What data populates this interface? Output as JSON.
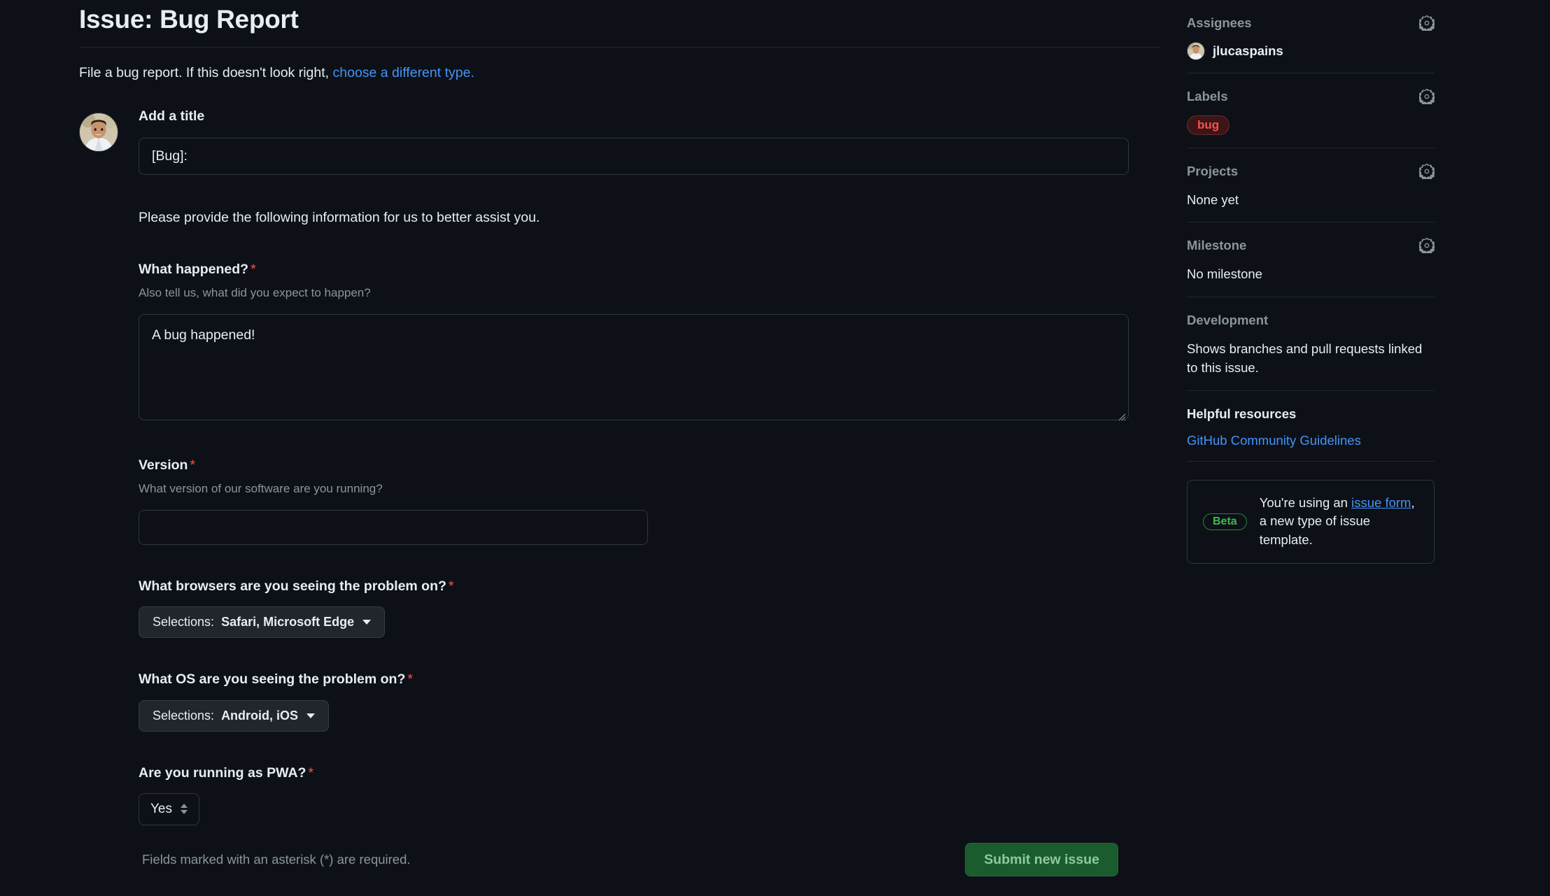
{
  "header": {
    "title": "Issue: Bug Report",
    "intro_prefix": "File a bug report. If this doesn't look right, ",
    "intro_link": "choose a different type."
  },
  "compose": {
    "title_label": "Add a title",
    "title_value": "[Bug]:",
    "title_placeholder": "Title"
  },
  "form": {
    "helper_text": "Please provide the following information for us to better assist you.",
    "required_marker": "*",
    "fields": [
      {
        "label": "What happened?",
        "description": "Also tell us, what did you expect to happen?",
        "value": "A bug happened!",
        "required": true,
        "type": "textarea"
      },
      {
        "label": "Version",
        "description": "What version of our software are you running?",
        "value": "",
        "required": true,
        "type": "text"
      },
      {
        "label": "What browsers are you seeing the problem on?",
        "required": true,
        "type": "multiselect",
        "selections_prefix": "Selections:",
        "selections_values": "Safari, Microsoft Edge"
      },
      {
        "label": "What OS are you seeing the problem on?",
        "required": true,
        "type": "multiselect",
        "selections_prefix": "Selections:",
        "selections_values": "Android, iOS"
      },
      {
        "label": "Are you running as PWA?",
        "required": true,
        "type": "select",
        "value": "Yes"
      }
    ]
  },
  "footer": {
    "required_note": "Fields marked with an asterisk (*) are required.",
    "submit_label": "Submit new issue"
  },
  "sidebar": {
    "assignees": {
      "title": "Assignees",
      "gear_icon": "gear-icon",
      "user": "jlucaspains"
    },
    "labels": {
      "title": "Labels",
      "gear_icon": "gear-icon",
      "items": [
        "bug"
      ]
    },
    "projects": {
      "title": "Projects",
      "gear_icon": "gear-icon",
      "value": "None yet"
    },
    "milestone": {
      "title": "Milestone",
      "gear_icon": "gear-icon",
      "value": "No milestone"
    },
    "development": {
      "title": "Development",
      "value": "Shows branches and pull requests linked to this issue."
    },
    "helpful_resources": {
      "title": "Helpful resources",
      "link": "GitHub Community Guidelines"
    },
    "beta_callout": {
      "badge": "Beta",
      "text_before": "You're using an ",
      "link": "issue form",
      "text_after": ", a new type of issue template."
    }
  },
  "colors": {
    "background": "#0d1117",
    "accent_link": "#4493f8",
    "required_red": "#f85149",
    "submit_green": "#1a5c2d",
    "beta_green": "#3fb950"
  }
}
